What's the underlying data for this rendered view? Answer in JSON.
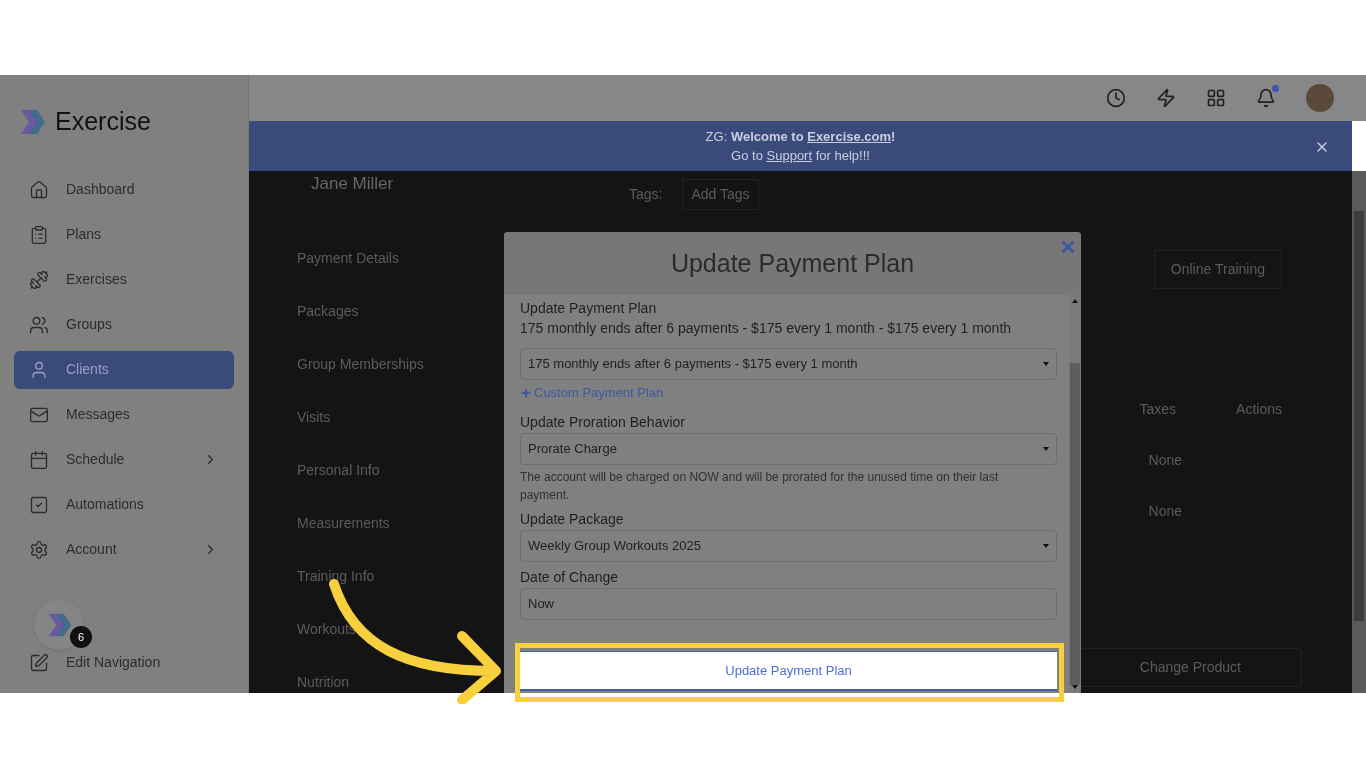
{
  "logo": "Exercise",
  "sidebar": {
    "items": [
      {
        "label": "Dashboard",
        "selected": false,
        "expandable": false
      },
      {
        "label": "Plans",
        "selected": false,
        "expandable": false
      },
      {
        "label": "Exercises",
        "selected": false,
        "expandable": false
      },
      {
        "label": "Groups",
        "selected": false,
        "expandable": false
      },
      {
        "label": "Clients",
        "selected": true,
        "expandable": false
      },
      {
        "label": "Messages",
        "selected": false,
        "expandable": false
      },
      {
        "label": "Schedule",
        "selected": false,
        "expandable": true
      },
      {
        "label": "Automations",
        "selected": false,
        "expandable": false
      },
      {
        "label": "Account",
        "selected": false,
        "expandable": true
      }
    ],
    "footer": {
      "label": "Edit Navigation",
      "badge": "6"
    }
  },
  "header": {
    "notification_dot": true
  },
  "banner": {
    "line1": {
      "before": "ZG: **Welcome to** ",
      "link": "Exercise.com",
      "after": "**!**"
    },
    "line2": {
      "before": "Go to ",
      "link": "Support",
      "after": " for help!!!"
    }
  },
  "client": {
    "name": "Jane Miller",
    "tags_label": "Tags:",
    "tags_placeholder": "Add Tags"
  },
  "client_menu": [
    "Payment Details",
    "Packages",
    "Group Memberships",
    "Visits",
    "Personal Info",
    "Measurements",
    "Training Info",
    "Workouts",
    "Nutrition"
  ],
  "tab": "Online Training",
  "table": {
    "columns": [
      "Taxes",
      "Actions"
    ],
    "rows": [
      [
        "None"
      ],
      [
        "None"
      ]
    ]
  },
  "change_button": "Change Product",
  "modal": {
    "title": "Update Payment Plan",
    "fields": [
      {
        "kind": "current",
        "label": "Update Payment Plan",
        "value": "175 monthly ends after 6 payments - $175 every 1 month - $175 every 1 month"
      },
      {
        "kind": "select",
        "value": "175 monthly ends after 6 payments - $175 every 1 month"
      },
      {
        "kind": "link",
        "value": "Custom Payment Plan"
      },
      {
        "kind": "select",
        "label": "Update Proration Behavior",
        "value": "Prorate Charge",
        "help": "The account will be charged on NOW and will be prorated for the unused time on their last payment."
      },
      {
        "kind": "select",
        "label": "Update Package",
        "value": "Weekly Group Workouts 2025"
      },
      {
        "kind": "input",
        "label": "Date of Change",
        "value": "Now"
      }
    ],
    "submit": "Update Payment Plan"
  }
}
